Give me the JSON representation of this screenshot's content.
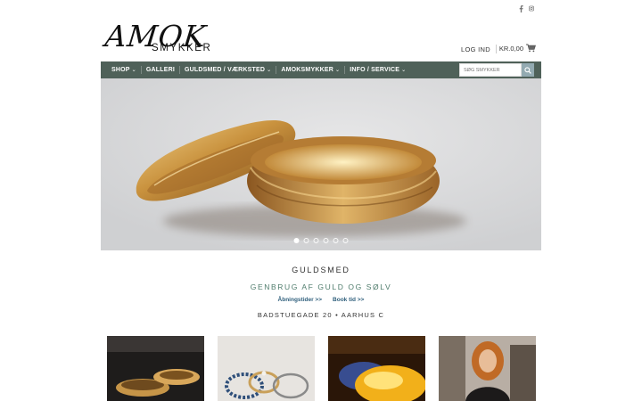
{
  "social": {
    "facebook_icon": "facebook-icon",
    "instagram_icon": "instagram-icon"
  },
  "logo": {
    "amok": "AMOK",
    "smykker": "SMYKKER"
  },
  "header": {
    "login_label": "LOG IND",
    "cart_label": "KR.0,00",
    "cart_icon": "cart-icon"
  },
  "nav": {
    "items": [
      {
        "label": "SHOP",
        "has_dropdown": true
      },
      {
        "label": "GALLERI",
        "has_dropdown": false
      },
      {
        "label": "GULDSMED / VÆRKSTED",
        "has_dropdown": true
      },
      {
        "label": "AMOKSMYKKER",
        "has_dropdown": true
      },
      {
        "label": "INFO / SERVICE",
        "has_dropdown": true
      }
    ],
    "search_placeholder": "SØG SMYKKER",
    "search_icon": "search-icon"
  },
  "hero": {
    "slide_count": 6,
    "active_slide": 1
  },
  "intro": {
    "title": "GULDSMED",
    "subtitle": "GENBRUG AF GULD OG SØLV",
    "link_hours": "Åbningstider >>",
    "link_book": "Book tid >>",
    "address": "BADSTUEGADE 20 • AARHUS C"
  },
  "colors": {
    "nav_bg": "#4f6159",
    "accent_green": "#4f7c6c",
    "link_blue": "#2f5f7c",
    "search_btn": "#93aab1"
  }
}
